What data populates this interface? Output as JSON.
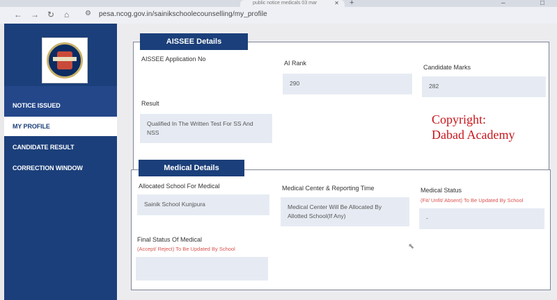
{
  "browser": {
    "tab_title": "public notice medicals 03 mar",
    "url": "pesa.ncog.gov.in/sainikschoolecounselling/my_profile"
  },
  "sidebar": {
    "items": [
      {
        "label": "NOTICE ISSUED",
        "active": false
      },
      {
        "label": "MY PROFILE",
        "active": true
      },
      {
        "label": "CANDIDATE RESULT",
        "active": false
      },
      {
        "label": "CORRECTION WINDOW",
        "active": false
      }
    ]
  },
  "aissee": {
    "header": "AISSEE Details",
    "application_no_label": "AISSEE Application No",
    "application_no_value": "",
    "rank_label": "AI Rank",
    "rank_value": "290",
    "marks_label": "Candidate Marks",
    "marks_value": "282",
    "result_label": "Result",
    "result_value": "Qualified In The Written Test For SS And NSS"
  },
  "medical": {
    "header": "Medical Details",
    "school_label": "Allocated School For Medical",
    "school_value": "Sainik School Kunjpura",
    "center_label": "Medical Center & Reporting Time",
    "center_value": "Medical Center Will Be Allocated By Allotted School(If Any)",
    "status_label": "Medical Status",
    "status_sub": "(Fit/ Unfit/ Absent) To Be Updated By School",
    "status_value": "-",
    "final_label": "Final Status Of Medical",
    "final_sub": "(Accept/ Reject) To Be Updated By School",
    "final_value": ""
  },
  "watermark": {
    "line1": "Copyright:",
    "line2": "Dabad Academy"
  },
  "colors": {
    "sidebar": "#1b3f7a",
    "header": "#1b3f7a",
    "field": "#e6ebf3",
    "watermark": "#c8151b",
    "sub_label": "#d9534f"
  }
}
